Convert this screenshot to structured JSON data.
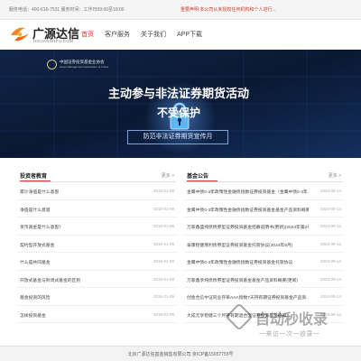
{
  "topbar": {
    "contact": "服务电话：400-616-7531   服务时间：工作日09:00至18:00",
    "notice": "重要声明:本公司从未授权任何机构和个人进行..."
  },
  "header": {
    "logo_text": "广源达信",
    "logo_sub": "HGUANSHFU.COM"
  },
  "nav": [
    "首页",
    "客户服务",
    "关于我们",
    "APP下载"
  ],
  "banner": {
    "association_name": "中国证券投资基金业协会",
    "association_en": "Asset Management Association of China",
    "headline": "主动参与非法证券期货活动",
    "subline": "不受保护",
    "tagline": "防范非法证券期货宣传月"
  },
  "left_panel": {
    "title": "投资者教育",
    "more": "更多 >",
    "rows": [
      {
        "title": "累计净值是什么意思",
        "date": "2016-01-09"
      },
      {
        "title": "净值是什么意思",
        "date": "2016-01-09"
      },
      {
        "title": "货币基金是什么意思？",
        "date": "2016-01-09"
      },
      {
        "title": "契约型开放式基金",
        "date": "2016-01-09"
      },
      {
        "title": "什么是共同基金",
        "date": "2016-01-09"
      },
      {
        "title": "开放式基金与封闭式基金的区别",
        "date": "2016-01-09"
      },
      {
        "title": "基金投资的风险",
        "date": "2016-01-09"
      },
      {
        "title": "怎样投资基金",
        "date": "2016-01-09"
      }
    ]
  },
  "right_panel": {
    "title": "基金公告",
    "more": "更多 >",
    "rows": [
      {
        "title": "金鹰中债0-3年政策性金融债指数证券投资基金（金鹰中债0-3年...",
        "date": "2024-09-14"
      },
      {
        "title": "金鹰中债0-3年政策性金融债指数证券投资基金基金产品资料概要",
        "date": "2024-09-14"
      },
      {
        "title": "万家鑫盛纯债债券型证券投资基金招募说明书(更新)(2024年第2号)",
        "date": "2024-09-14"
      },
      {
        "title": "泰康稳健增利债券型证券投资基金托管协议(2024年9月)",
        "date": "2024-09-14"
      },
      {
        "title": "金鹰中债0-3年政策性金融债指数证券投资基金托管协议",
        "date": "2024-09-14"
      },
      {
        "title": "万家鑫享纯债债券型证券投资基金基金产品资料概要(更新)",
        "date": "2024-09-14"
      },
      {
        "title": "创金合信中证同业存单AAA指数7天持有期证券投资基金产品资...",
        "date": "2024-09-14"
      },
      {
        "title": "大成元享稳健三个月持有期混合型证券投资基金招募...",
        "date": "2024-09-14"
      }
    ]
  },
  "footer": {
    "text": "北京广源达信基金销售有限公司 京ICP备15057755号"
  },
  "watermark": {
    "text": "自动秒收录",
    "sub": "一来访一次一收录一"
  },
  "colors": {
    "accent": "#d03a2b",
    "banner_bg": "#0d1b3a"
  }
}
